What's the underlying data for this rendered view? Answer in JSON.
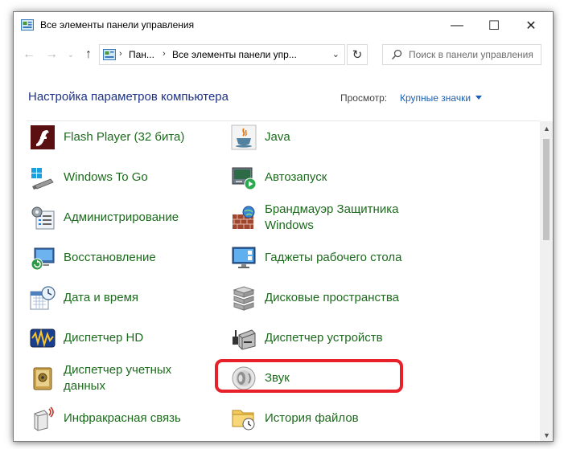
{
  "window": {
    "title": "Все элементы панели управления"
  },
  "titlebar_buttons": {
    "minimize": "—",
    "maximize": "☐",
    "close": "✕"
  },
  "nav": {
    "back": "←",
    "forward": "→",
    "recent": "⌄",
    "up": "↑",
    "refresh": "↻"
  },
  "address": {
    "segments": [
      "Пан...",
      "Все элементы панели упр..."
    ],
    "separator": "›",
    "dropdown": "⌄"
  },
  "search": {
    "placeholder": "Поиск в панели управления"
  },
  "header": {
    "title": "Настройка параметров компьютера",
    "view_label": "Просмотр:",
    "view_value": "Крупные значки"
  },
  "scrollbar": {
    "up": "▲",
    "down": "▼"
  },
  "items": [
    {
      "label": "Flash Player (32 бита)",
      "icon": "flash-player-icon"
    },
    {
      "label": "Java",
      "icon": "java-icon"
    },
    {
      "label": "Windows To Go",
      "icon": "windows-to-go-icon"
    },
    {
      "label": "Автозапуск",
      "icon": "autoplay-icon"
    },
    {
      "label": "Администрирование",
      "icon": "administrative-tools-icon"
    },
    {
      "label": "Брандмауэр Защитника",
      "label2": "Windows",
      "icon": "firewall-icon"
    },
    {
      "label": "Восстановление",
      "icon": "recovery-icon"
    },
    {
      "label": "Гаджеты рабочего стола",
      "icon": "desktop-gadgets-icon"
    },
    {
      "label": "Дата и время",
      "icon": "date-time-icon"
    },
    {
      "label": "Дисковые пространства",
      "icon": "storage-spaces-icon"
    },
    {
      "label": "Диспетчер HD",
      "icon": "hd-audio-manager-icon"
    },
    {
      "label": "Диспетчер устройств",
      "icon": "device-manager-icon"
    },
    {
      "label": "Диспетчер учетных",
      "label2": "данных",
      "icon": "credential-manager-icon"
    },
    {
      "label": "Звук",
      "icon": "sound-icon",
      "highlighted": true
    },
    {
      "label": "Инфракрасная связь",
      "icon": "infrared-icon"
    },
    {
      "label": "История файлов",
      "icon": "file-history-icon"
    }
  ],
  "colors": {
    "link_green": "#1c6b1c",
    "title_blue": "#1e3287",
    "accent_blue": "#1a5fb4",
    "highlight_red": "#e8202a"
  }
}
